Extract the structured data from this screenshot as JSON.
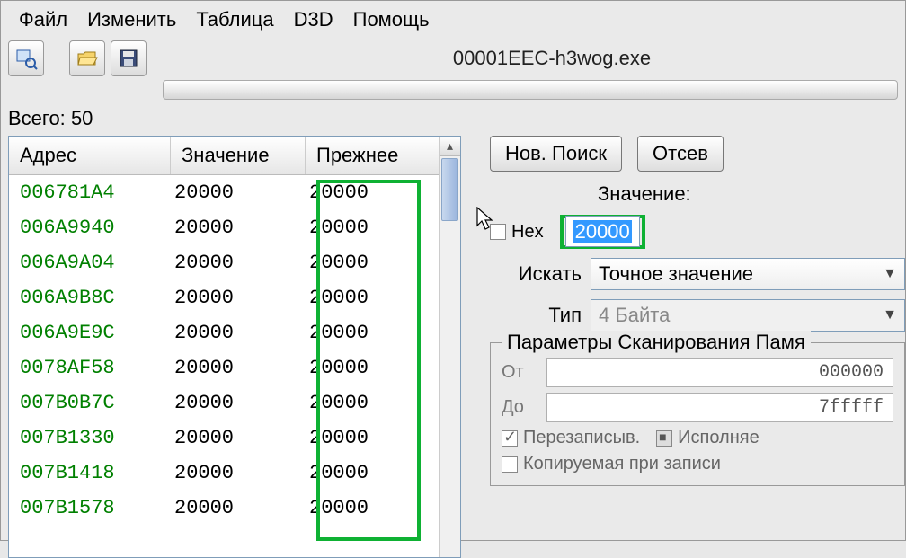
{
  "menu": {
    "file": "Файл",
    "edit": "Изменить",
    "table": "Таблица",
    "d3d": "D3D",
    "help": "Помощь"
  },
  "title": "00001EEC-h3wog.exe",
  "total_label": "Всего:",
  "total_count": "50",
  "columns": {
    "address": "Адрес",
    "value": "Значение",
    "previous": "Прежнее"
  },
  "rows": [
    {
      "addr": "006781A4",
      "val": "20000",
      "prev": "20000"
    },
    {
      "addr": "006A9940",
      "val": "20000",
      "prev": "20000"
    },
    {
      "addr": "006A9A04",
      "val": "20000",
      "prev": "20000"
    },
    {
      "addr": "006A9B8C",
      "val": "20000",
      "prev": "20000"
    },
    {
      "addr": "006A9E9C",
      "val": "20000",
      "prev": "20000"
    },
    {
      "addr": "0078AF58",
      "val": "20000",
      "prev": "20000"
    },
    {
      "addr": "007B0B7C",
      "val": "20000",
      "prev": "20000"
    },
    {
      "addr": "007B1330",
      "val": "20000",
      "prev": "20000"
    },
    {
      "addr": "007B1418",
      "val": "20000",
      "prev": "20000"
    },
    {
      "addr": "007B1578",
      "val": "20000",
      "prev": "20000"
    }
  ],
  "buttons": {
    "new_search": "Нов. Поиск",
    "filter": "Отсев"
  },
  "labels": {
    "value": "Значение:",
    "hex": "Hex",
    "search": "Искать",
    "type": "Тип",
    "scan_params": "Параметры Сканирования Памя",
    "from": "От",
    "to": "До",
    "overwrite": "Перезаписыв.",
    "exec": "Исполняе",
    "copy_on_write": "Копируемая при записи"
  },
  "values": {
    "search_value": "20000",
    "search_mode": "Точное значение",
    "type": "4 Байта",
    "from": "000000",
    "to": "7fffff"
  }
}
